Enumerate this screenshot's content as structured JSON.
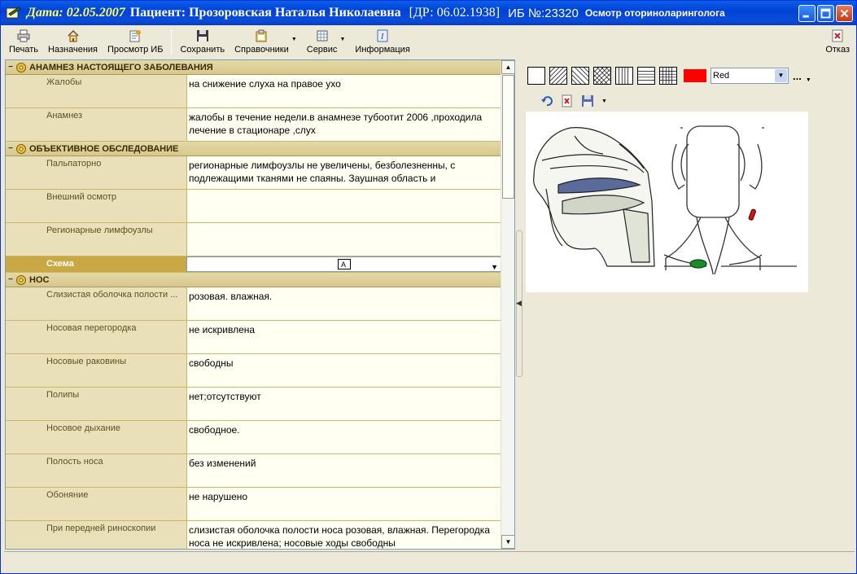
{
  "window": {
    "date_label": "Дата: 02.05.2007",
    "patient_label": "Пациент: Прозоровская Наталья Николаевна",
    "dob_label": "[ДР: 06.02.1938]",
    "ib_label": "ИБ №:23320",
    "exam_title": "Осмотр оториноларинголога"
  },
  "toolbar": {
    "print": "Печать",
    "assignments": "Назначения",
    "view_ib": "Просмотр ИБ",
    "save": "Сохранить",
    "references": "Справочники",
    "service": "Сервис",
    "info": "Информация",
    "cancel": "Отказ"
  },
  "sections": [
    {
      "title": "АНАМНЕЗ НАСТОЯЩЕГО ЗАБОЛЕВАНИЯ",
      "rows": [
        {
          "label": "Жалобы",
          "value": "на снижение слуха на правое ухо"
        },
        {
          "label": "Анамнез",
          "value": "жалобы в течение недели.в анамнезе тубоотит 2006 ,проходила лечение в стационаре ,слух"
        }
      ]
    },
    {
      "title": "ОБЪЕКТИВНОЕ ОБСЛЕДОВАНИЕ",
      "rows": [
        {
          "label": "Пальпаторно",
          "value": "регионарные лимфоузлы не увеличены, безболезненны, с подлежащими тканями не спаяны. Заушная область и"
        },
        {
          "label": "Внешний осмотр",
          "value": ""
        },
        {
          "label": "Регионарные лимфоузлы",
          "value": ""
        }
      ],
      "schema_label": "Схема"
    },
    {
      "title": "НОС",
      "rows": [
        {
          "label": "Слизистая оболочка полости ...",
          "value": "розовая. влажная."
        },
        {
          "label": "Носовая перегородка",
          "value": "не искривлена"
        },
        {
          "label": "Носовые раковины",
          "value": "свободны"
        },
        {
          "label": "Полипы",
          "value": "нет;отсутствуют"
        },
        {
          "label": "Носовое дыхание",
          "value": "свободное."
        },
        {
          "label": "Полость носа",
          "value": "без изменений"
        },
        {
          "label": "Обоняние",
          "value": "не нарушено"
        },
        {
          "label": "При передней риноскопии",
          "value": "слизистая оболочка полости носа розовая, влажная. Перегородка носа не искривлена; носовые ходы свободны"
        }
      ]
    }
  ],
  "draw": {
    "color_name": "Red",
    "color_hex": "#ff0000",
    "more": "..."
  }
}
